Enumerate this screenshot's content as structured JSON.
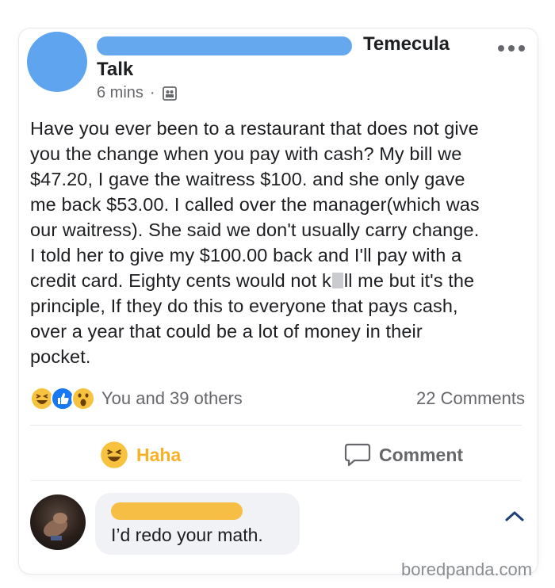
{
  "post": {
    "group_name_line1": "Temecula",
    "group_name_line2": "Talk",
    "time": "6 mins",
    "separator": "·",
    "audience_icon": "group-audience-icon",
    "body_lines": [
      "Have you ever been to a restaurant that does not give",
      "you the change when you pay with cash? My bill we",
      "$47.20, I gave the waitress $100. and she only gave",
      "me back $53.00. I called over the manager(which was",
      "our waitress). She said we don't usually carry change.",
      "I told her to give my $100.00 back and I'll pay with a",
      "credit card. Eighty cents would not k",
      "ll me but it's the",
      "principle, If they do this to everyone that pays cash,",
      "over a year that could be a lot of money in their",
      "pocket."
    ]
  },
  "reactions": {
    "icons": [
      "haha-icon",
      "like-icon",
      "wow-icon"
    ],
    "summary": "You and 39 others",
    "comments_count": "22 Comments"
  },
  "actions": {
    "haha_label": "Haha",
    "comment_label": "Comment"
  },
  "comment": {
    "text": "I’d redo your math."
  },
  "watermark": "boredpanda.com",
  "colors": {
    "name_redaction": "#66a8ee",
    "commenter_redaction": "#f7be45",
    "haha_yellow": "#f7b125",
    "like_blue": "#1877f2",
    "secondary_text": "#65676b"
  }
}
